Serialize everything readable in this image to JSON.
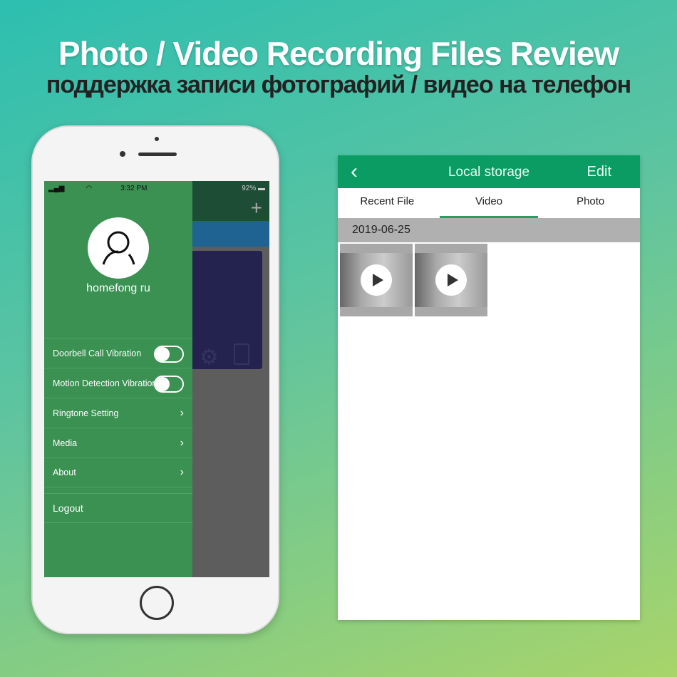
{
  "headline": "Photo / Video Recording Files Review",
  "subheadline": "поддержка записи фотографий / видео на телефон",
  "phone": {
    "status": {
      "time": "3:32 PM",
      "battery": "92%"
    },
    "drawer": {
      "username": "homefong ru",
      "items": [
        {
          "label": "Doorbell Call Vibration",
          "type": "toggle",
          "on": false
        },
        {
          "label": "Motion Detection Vibration",
          "type": "toggle",
          "on": false
        },
        {
          "label": "Ringtone Setting",
          "type": "link"
        },
        {
          "label": "Media",
          "type": "link"
        },
        {
          "label": "About",
          "type": "link"
        }
      ],
      "logout": "Logout"
    }
  },
  "storage": {
    "title": "Local storage",
    "edit": "Edit",
    "tabs": [
      "Recent File",
      "Video",
      "Photo"
    ],
    "active_tab": "Video",
    "date": "2019-06-25",
    "video_count": 2
  },
  "colors": {
    "drawer": "#3a9152",
    "header": "#0a9c62"
  }
}
